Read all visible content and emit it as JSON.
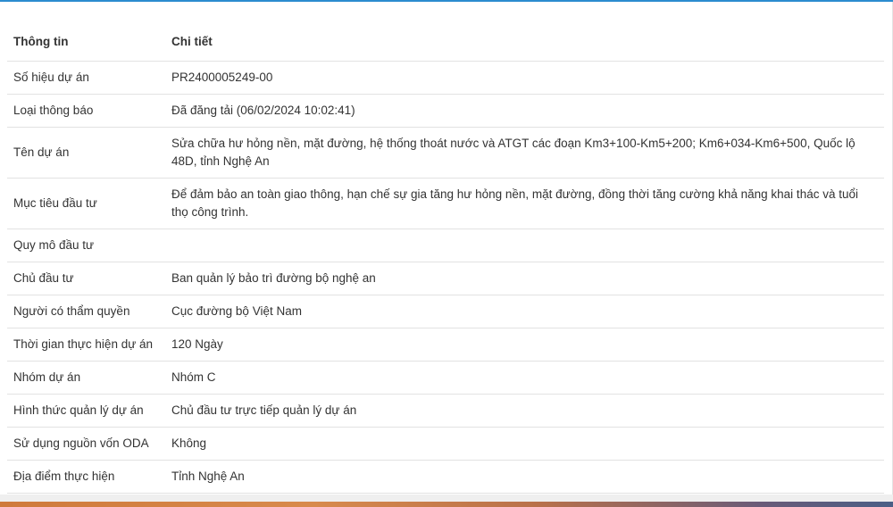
{
  "table": {
    "header": {
      "label": "Thông tin",
      "value": "Chi tiết"
    },
    "rows": [
      {
        "label": "Số hiệu dự án",
        "value": "PR2400005249-00"
      },
      {
        "label": "Loại thông báo",
        "value": "Đã đăng tải (06/02/2024 10:02:41)"
      },
      {
        "label": "Tên dự án",
        "value": "Sửa chữa hư hỏng nền, mặt đường, hệ thống thoát nước và ATGT các đoạn Km3+100-Km5+200; Km6+034-Km6+500, Quốc lộ 48D, tỉnh Nghệ An"
      },
      {
        "label": "Mục tiêu đầu tư",
        "value": "Để đảm bảo an toàn giao thông, hạn chế sự gia tăng hư hỏng nền, mặt đường, đồng thời tăng cường khả năng khai thác và tuổi thọ công trình."
      },
      {
        "label": "Quy mô đầu tư",
        "value": ""
      },
      {
        "label": "Chủ đầu tư",
        "value": "Ban quản lý bảo trì đường bộ nghệ an"
      },
      {
        "label": "Người có thẩm quyền",
        "value": "Cục đường bộ Việt Nam"
      },
      {
        "label": "Thời gian thực hiện dự án",
        "value": "120 Ngày"
      },
      {
        "label": "Nhóm dự án",
        "value": "Nhóm C"
      },
      {
        "label": "Hình thức quản lý dự án",
        "value": "Chủ đầu tư trực tiếp quản lý dự án"
      },
      {
        "label": "Sử dụng nguồn vốn ODA",
        "value": "Không"
      },
      {
        "label": "Địa điểm thực hiện",
        "value": "Tỉnh Nghệ An"
      }
    ]
  },
  "colors": {
    "accent": "#2b8ccf",
    "project_name": "#d93a1a",
    "link": "#2b8fd6",
    "text": "#333333"
  }
}
